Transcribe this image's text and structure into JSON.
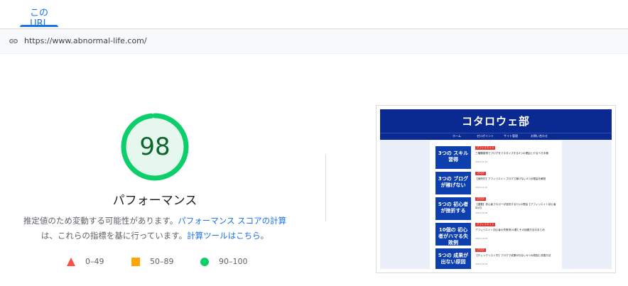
{
  "tabs": [
    {
      "label": "この URL",
      "active": true
    }
  ],
  "url_bar": {
    "icon": "link-icon",
    "url": "https://www.abnormal-life.com/"
  },
  "score": {
    "value": 98,
    "fraction": 0.98,
    "color": "#0cce6b"
  },
  "category": {
    "title": "パフォーマンス"
  },
  "description": {
    "prefix": "推定値のため変動する可能性があります。",
    "link1": "パフォーマンス スコアの計算",
    "middle": "は、これらの指標を基に行っています。",
    "link2": "計算ツールはこちら",
    "suffix": "。"
  },
  "legend": [
    {
      "shape": "triangle",
      "color": "#ff4e42",
      "label": "0–49"
    },
    {
      "shape": "square",
      "color": "#ffa400",
      "label": "50–89"
    },
    {
      "shape": "circle",
      "color": "#0cce6b",
      "label": "90–100"
    }
  ],
  "screenshot": {
    "logo": "コタロウェ部",
    "nav": [
      "ホーム",
      "ゼロポイント",
      "サイト管理",
      "お問い合わせ"
    ],
    "posts": [
      {
        "thumb": "3つの スキル習得",
        "category": "アフィリエイト",
        "title": "三種類習得でブログをマネタイズする3つの理由とやるべき手順",
        "date": "2020.12.14"
      },
      {
        "thumb": "3つの ブログが稼げない",
        "category": "ブログ",
        "title": "【実例付】アフィリエイトブログで稼げない3つの理由を解説",
        "date": "2020.12.10"
      },
      {
        "thumb": "5つの 初心者が挫折する",
        "category": "ブログ",
        "title": "【重要】初心者ブロガーが挫折する5つの理由【アフィリエイト初心者向け】",
        "date": "2020.12.08"
      },
      {
        "thumb": "10個の 初心者がハマる失敗例",
        "category": "アフィリエイト",
        "title": "アフィリエイト初心者の失敗例10選とその回避方法のまとめ",
        "date": "2020.12.06"
      },
      {
        "thumb": "5つの 成果が出ない原因",
        "category": "ブログ",
        "title": "【チェックリスト付】ブログで成果が出ない5つの原因と改善方法",
        "date": "2020.12.03"
      }
    ]
  }
}
